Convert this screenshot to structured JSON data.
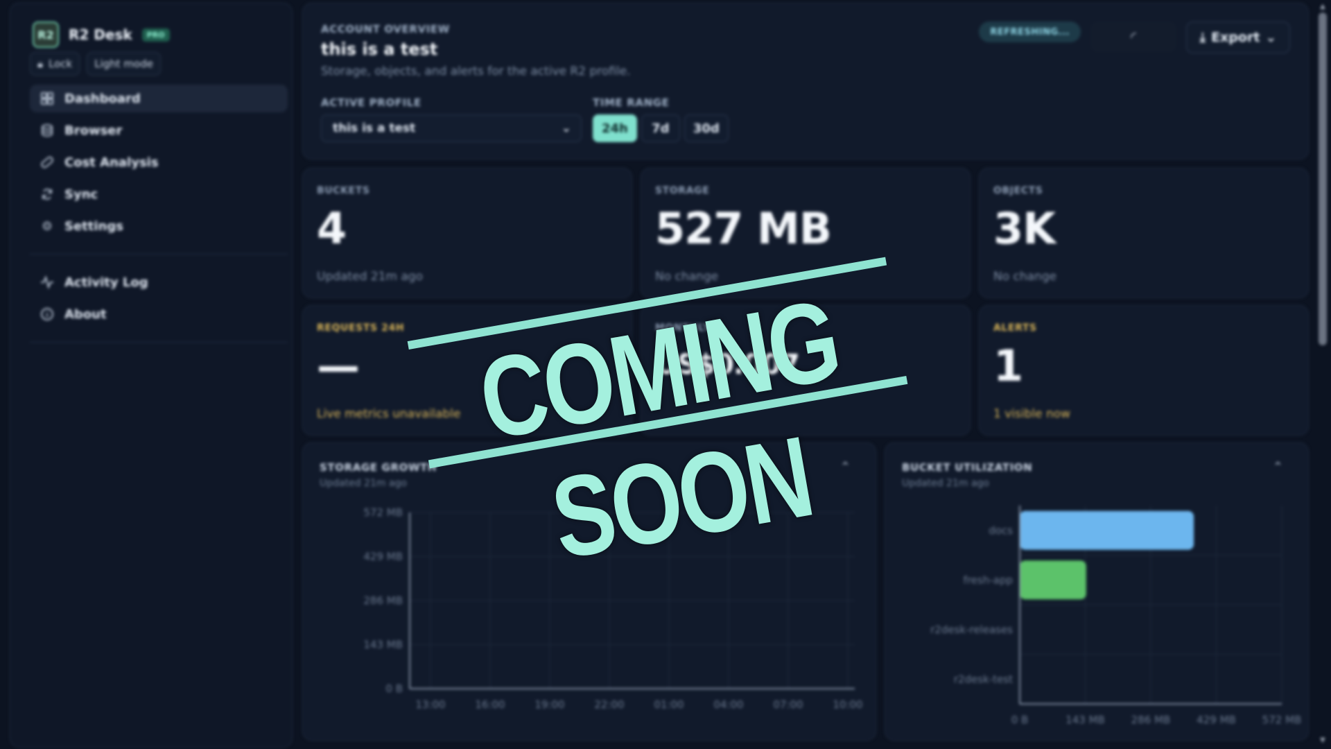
{
  "brand": {
    "name": "R2 Desk",
    "badge": "PRO",
    "logo_text": "R2"
  },
  "sidebar": {
    "lock_label": "Lock",
    "theme_label": "Light mode",
    "nav": [
      {
        "label": "Dashboard",
        "icon": "dashboard-icon",
        "active": true
      },
      {
        "label": "Browser",
        "icon": "database-icon"
      },
      {
        "label": "Cost Analysis",
        "icon": "pill-icon"
      },
      {
        "label": "Sync",
        "icon": "sync-icon"
      },
      {
        "label": "Settings",
        "icon": "gear-icon"
      }
    ],
    "secondary": [
      {
        "label": "Activity Log",
        "icon": "activity-icon"
      },
      {
        "label": "About",
        "icon": "info-icon"
      }
    ]
  },
  "overview": {
    "eyebrow": "ACCOUNT OVERVIEW",
    "title": "this is a test",
    "subtitle": "Storage, objects, and alerts for the active R2 profile.",
    "profile_label": "ACTIVE PROFILE",
    "profile_value": "this is a test",
    "time_range_label": "TIME RANGE",
    "time_ranges": [
      "24h",
      "7d",
      "30d"
    ],
    "selected_range": "24h",
    "refreshing_label": "REFRESHING...",
    "export_label": "Export"
  },
  "stats": {
    "buckets": {
      "label": "BUCKETS",
      "value": "4",
      "note": "Updated 21m ago"
    },
    "storage": {
      "label": "STORAGE",
      "value": "527 MB",
      "note": "No change"
    },
    "objects": {
      "label": "OBJECTS",
      "value": "3K",
      "note": "No change"
    },
    "requests": {
      "label": "REQUESTS 24H",
      "value": "—",
      "note": "Live metrics unavailable"
    },
    "monthly": {
      "label": "MONTHLY",
      "value": "US$0.007",
      "note": ""
    },
    "alerts": {
      "label": "ALERTS",
      "value": "1",
      "note": "1 visible now"
    }
  },
  "storage_growth": {
    "title": "STORAGE GROWTH",
    "subtitle": "Updated 21m ago"
  },
  "bucket_utilization": {
    "title": "BUCKET UTILIZATION",
    "subtitle": "Updated 21m ago"
  },
  "overlay": {
    "text": "COMING SOON"
  },
  "colors": {
    "accent": "#7fe0cd",
    "warning": "#d9b559",
    "bar_blue": "#6cb6ee",
    "bar_green": "#5cc26a"
  },
  "chart_data": [
    {
      "type": "line",
      "title": "STORAGE GROWTH",
      "x": [
        "13:00",
        "16:00",
        "19:00",
        "22:00",
        "01:00",
        "04:00",
        "07:00",
        "10:00"
      ],
      "series": [],
      "y_ticks": [
        "0 B",
        "143 MB",
        "286 MB",
        "429 MB",
        "572 MB"
      ],
      "ylim": [
        0,
        572
      ],
      "grid": true
    },
    {
      "type": "bar",
      "orientation": "horizontal",
      "title": "BUCKET UTILIZATION",
      "categories": [
        "docs",
        "fresh-app",
        "r2desk-releases",
        "r2desk-test"
      ],
      "values": [
        380,
        145,
        0,
        0
      ],
      "x_ticks": [
        "0 B",
        "143 MB",
        "286 MB",
        "429 MB",
        "572 MB"
      ],
      "xlim": [
        0,
        572
      ],
      "grid": true
    }
  ]
}
